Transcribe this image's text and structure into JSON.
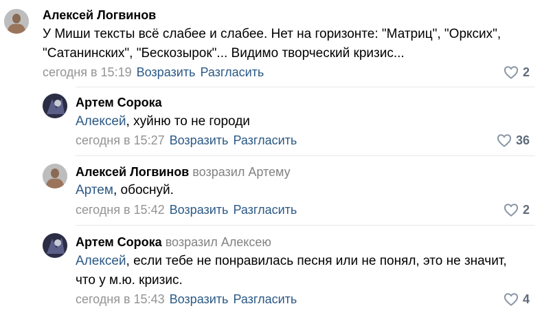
{
  "comments": [
    {
      "author": "Алексей Логвинов",
      "replied": "",
      "mention": "",
      "text_lines": [
        "У Миши тексты всё слабее и слабее. Нет на горизонте: \"Матриц\", \"Орксих\",",
        "\"Сатанинских\", \"Бескозырок\"... Видимо творческий кризис..."
      ],
      "time": "сегодня в 15:19",
      "reply_label": "Возразить",
      "disagree_label": "Разгласить",
      "likes": "2"
    },
    {
      "author": "Артем Сорока",
      "replied": "",
      "mention": "Алексей",
      "text_lines": [
        ", хуйню то не городи"
      ],
      "time": "сегодня в 15:27",
      "reply_label": "Возразить",
      "disagree_label": "Разгласить",
      "likes": "36"
    },
    {
      "author": "Алексей Логвинов",
      "replied": "возразил Артему",
      "mention": "Артем",
      "text_lines": [
        ", обоснуй."
      ],
      "time": "сегодня в 15:42",
      "reply_label": "Возразить",
      "disagree_label": "Разгласить",
      "likes": "2"
    },
    {
      "author": "Артем Сорока",
      "replied": "возразил Алексею",
      "mention": "Алексей",
      "text_lines": [
        ", если тебе не понравилась песня или не понял, это не значит,",
        "что у м.ю. кризис."
      ],
      "time": "сегодня в 15:43",
      "reply_label": "Возразить",
      "disagree_label": "Разгласить",
      "likes": "4"
    }
  ],
  "icons": {
    "like": "heart-icon"
  },
  "colors": {
    "link": "#2a5885",
    "meta": "#939393",
    "separator": "#e7e8ec"
  }
}
